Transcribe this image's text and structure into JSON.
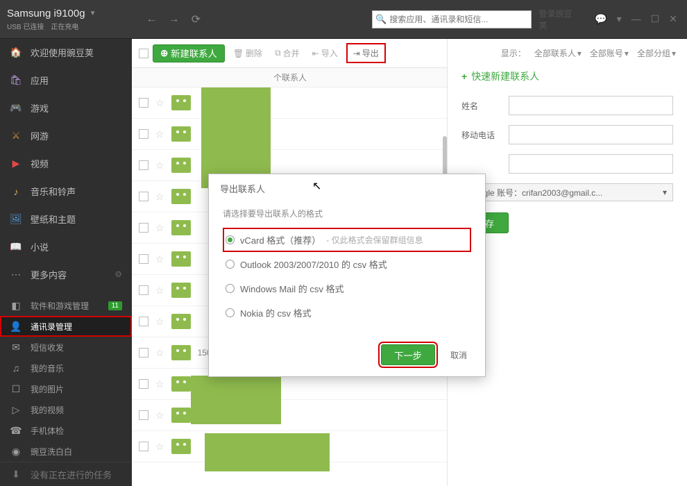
{
  "header": {
    "device_name": "Samsung i9100g",
    "usb_status": "USB 已连接",
    "charge_status": "正在充电",
    "search_placeholder": "搜索应用、通讯录和短信...",
    "login_label": "登录豌豆荚"
  },
  "sidebar": {
    "items": [
      {
        "label": "欢迎使用豌豆荚",
        "icon": "home"
      },
      {
        "label": "应用",
        "icon": "bag"
      },
      {
        "label": "游戏",
        "icon": "game"
      },
      {
        "label": "网游",
        "icon": "net"
      },
      {
        "label": "视频",
        "icon": "video"
      },
      {
        "label": "音乐和铃声",
        "icon": "music"
      },
      {
        "label": "壁纸和主题",
        "icon": "wall"
      },
      {
        "label": "小说",
        "icon": "book"
      },
      {
        "label": "更多内容",
        "icon": "more"
      }
    ],
    "manage": [
      {
        "label": "软件和游戏管理",
        "badge": "11"
      },
      {
        "label": "通讯录管理",
        "active": true
      },
      {
        "label": "短信收发"
      },
      {
        "label": "我的音乐"
      },
      {
        "label": "我的图片"
      },
      {
        "label": "我的视频"
      },
      {
        "label": "手机体检"
      },
      {
        "label": "豌豆洗白白"
      }
    ],
    "footer": "没有正在进行的任务"
  },
  "toolbar": {
    "new_contact": "新建联系人",
    "delete": "删除",
    "merge": "合并",
    "import": "导入",
    "export": "导出",
    "show_label": "显示：",
    "filter_all_contacts": "全部联系人",
    "filter_all_accounts": "全部账号",
    "filter_all_groups": "全部分组"
  },
  "list": {
    "section_suffix": "个联系人",
    "phone_sample": "15063322438"
  },
  "quick": {
    "title": "快速新建联系人",
    "name_label": "姓名",
    "phone_label": "移动电话",
    "account_text": "Google 账号：crifan2003@gmail.c...",
    "save": "保存"
  },
  "dialog": {
    "title": "导出联系人",
    "prompt": "请选择要导出联系人的格式",
    "options": [
      {
        "label": "vCard 格式（推荐）",
        "note": "- 仅此格式会保留群组信息",
        "checked": true
      },
      {
        "label": "Outlook 2003/2007/2010 的 csv 格式"
      },
      {
        "label": "Windows Mail 的 csv 格式"
      },
      {
        "label": "Nokia 的 csv 格式"
      }
    ],
    "next": "下一步",
    "cancel": "取消"
  }
}
